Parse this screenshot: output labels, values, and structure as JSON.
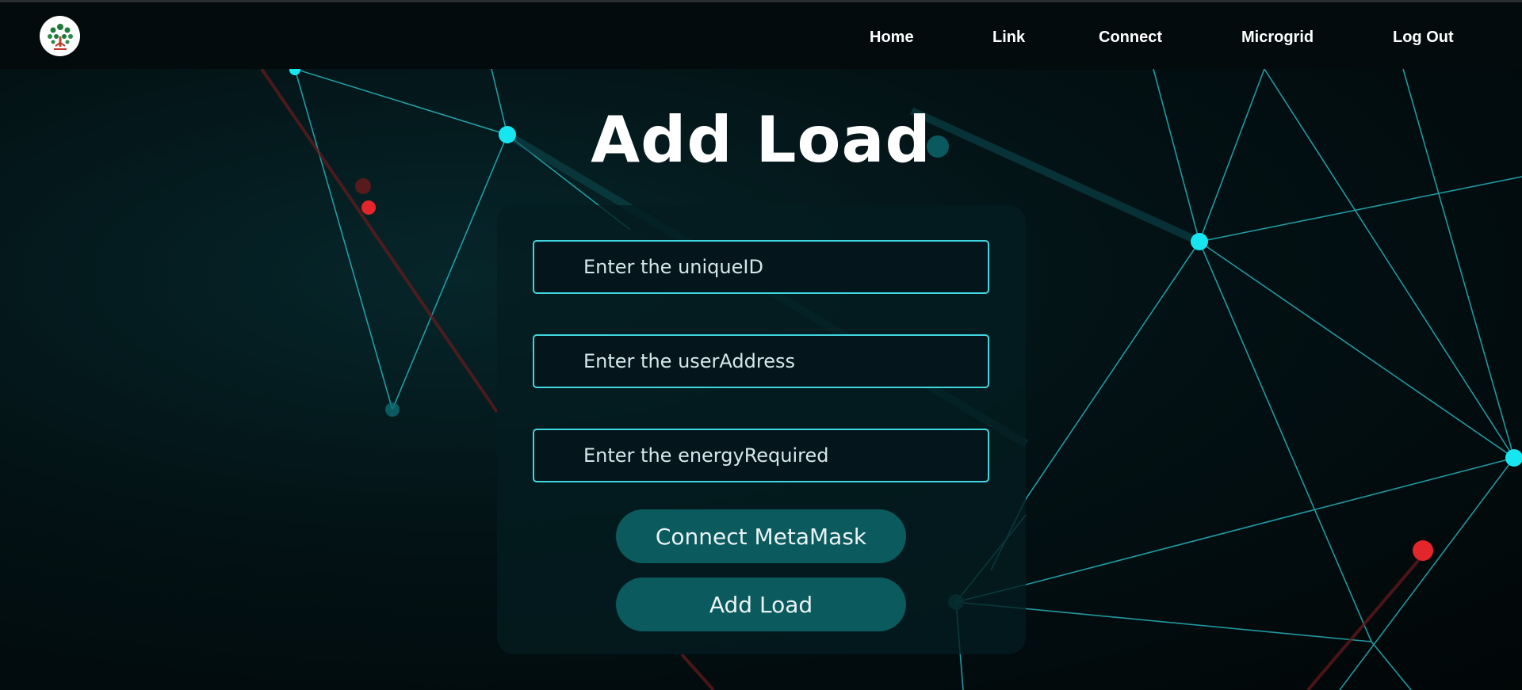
{
  "nav": {
    "links": [
      "Home",
      "Link",
      "Connect",
      "Microgrid",
      "Log Out"
    ]
  },
  "page": {
    "title": "Add Load"
  },
  "form": {
    "unique_id": {
      "placeholder": "Enter the uniqueID",
      "value": ""
    },
    "user_address": {
      "placeholder": "Enter the userAddress",
      "value": ""
    },
    "energy_required": {
      "placeholder": "Enter the energyRequired",
      "value": ""
    },
    "connect_button": "Connect MetaMask",
    "submit_button": "Add Load"
  },
  "colors": {
    "accent": "#3fd6e0",
    "button": "#0b5a5e",
    "navbar": "#030b0d",
    "node_cyan": "#17e6f0",
    "node_red": "#e2262b"
  },
  "icons": {
    "logo": "tree-logo-icon"
  }
}
